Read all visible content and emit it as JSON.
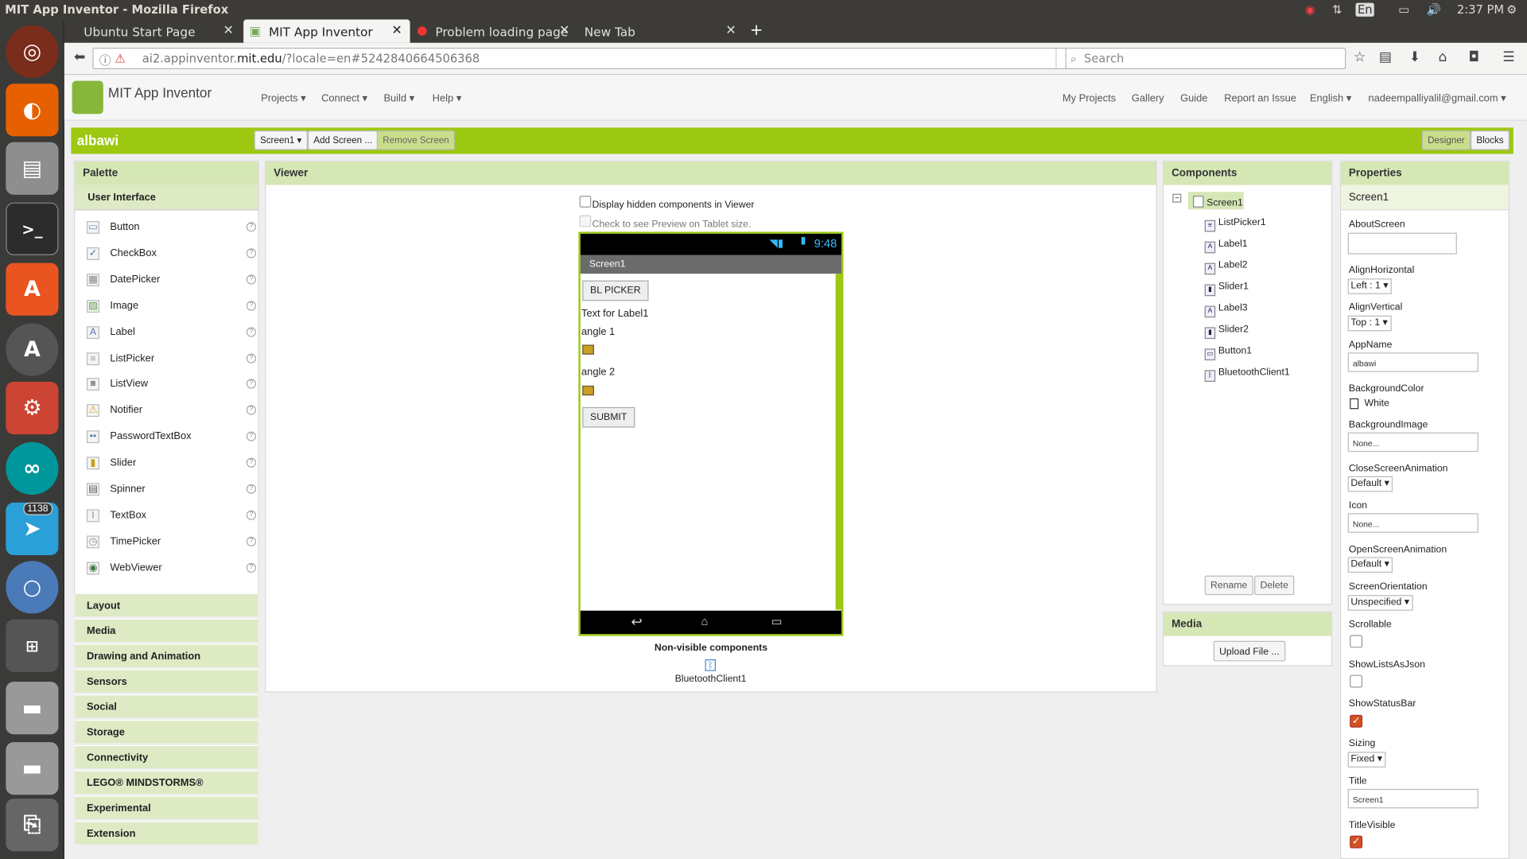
{
  "os": {
    "window_title": "MIT App Inventor - Mozilla Firefox",
    "time": "2:37 PM",
    "lang": "En",
    "badge_count": "1138"
  },
  "browser": {
    "tabs": [
      {
        "label": "Ubuntu Start Page"
      },
      {
        "label": "MIT App Inventor"
      },
      {
        "label": "Problem loading page"
      },
      {
        "label": "New Tab"
      }
    ],
    "url_prefix": "ai2.appinventor.",
    "url_domain": "mit.edu",
    "url_suffix": "/?locale=en#5242840664506368",
    "search_placeholder": "Search"
  },
  "app": {
    "name": "MIT App Inventor",
    "menu_left": [
      "Projects ▾",
      "Connect ▾",
      "Build ▾",
      "Help ▾"
    ],
    "menu_right": [
      "My Projects",
      "Gallery",
      "Guide",
      "Report an Issue",
      "English ▾",
      "nadeempalliyalil@gmail.com ▾"
    ],
    "project": "albawi",
    "screen_select": "Screen1 ▾",
    "add_screen": "Add Screen ...",
    "remove_screen": "Remove Screen",
    "designer": "Designer",
    "blocks": "Blocks"
  },
  "palette": {
    "title": "Palette",
    "section": "User Interface",
    "items": [
      "Button",
      "CheckBox",
      "DatePicker",
      "Image",
      "Label",
      "ListPicker",
      "ListView",
      "Notifier",
      "PasswordTextBox",
      "Slider",
      "Spinner",
      "TextBox",
      "TimePicker",
      "WebViewer"
    ],
    "categories": [
      "Layout",
      "Media",
      "Drawing and Animation",
      "Sensors",
      "Social",
      "Storage",
      "Connectivity",
      "LEGO® MINDSTORMS®",
      "Experimental",
      "Extension"
    ]
  },
  "viewer": {
    "title": "Viewer",
    "hidden_chk": "Display hidden components in Viewer",
    "tablet_chk": "Check to see Preview on Tablet size.",
    "phone_time": "9:48",
    "screen_title": "Screen1",
    "bl_picker": "BL PICKER",
    "label1": "Text for Label1",
    "label2": "angle 1",
    "label3": "angle 2",
    "submit": "SUBMIT",
    "nonvisible_title": "Non-visible components",
    "nonvisible_item": "BluetoothClient1"
  },
  "components": {
    "title": "Components",
    "root": "Screen1",
    "items": [
      "ListPicker1",
      "Label1",
      "Label2",
      "Slider1",
      "Label3",
      "Slider2",
      "Button1",
      "BluetoothClient1"
    ],
    "rename": "Rename",
    "delete": "Delete"
  },
  "media": {
    "title": "Media",
    "upload": "Upload File ..."
  },
  "properties": {
    "title": "Properties",
    "component": "Screen1",
    "about": "AboutScreen",
    "alignh": "AlignHorizontal",
    "alignh_val": "Left : 1 ▾",
    "alignv": "AlignVertical",
    "alignv_val": "Top : 1 ▾",
    "appname": "AppName",
    "appname_val": "albawi",
    "bgcolor": "BackgroundColor",
    "bgcolor_val": "White",
    "bgimage": "BackgroundImage",
    "bgimage_val": "None...",
    "closeanim": "CloseScreenAnimation",
    "closeanim_val": "Default ▾",
    "icon": "Icon",
    "icon_val": "None...",
    "openanim": "OpenScreenAnimation",
    "openanim_val": "Default ▾",
    "orient": "ScreenOrientation",
    "orient_val": "Unspecified ▾",
    "scrollable": "Scrollable",
    "scrollable_val": false,
    "showlists": "ShowListsAsJson",
    "showlists_val": false,
    "statusbar": "ShowStatusBar",
    "statusbar_val": true,
    "sizing": "Sizing",
    "sizing_val": "Fixed ▾",
    "title_lbl": "Title",
    "title_val": "Screen1",
    "titlevis": "TitleVisible",
    "titlevis_val": true
  },
  "colors": {
    "accent_green": "#9cc812",
    "header_green": "#d6e7b6"
  }
}
